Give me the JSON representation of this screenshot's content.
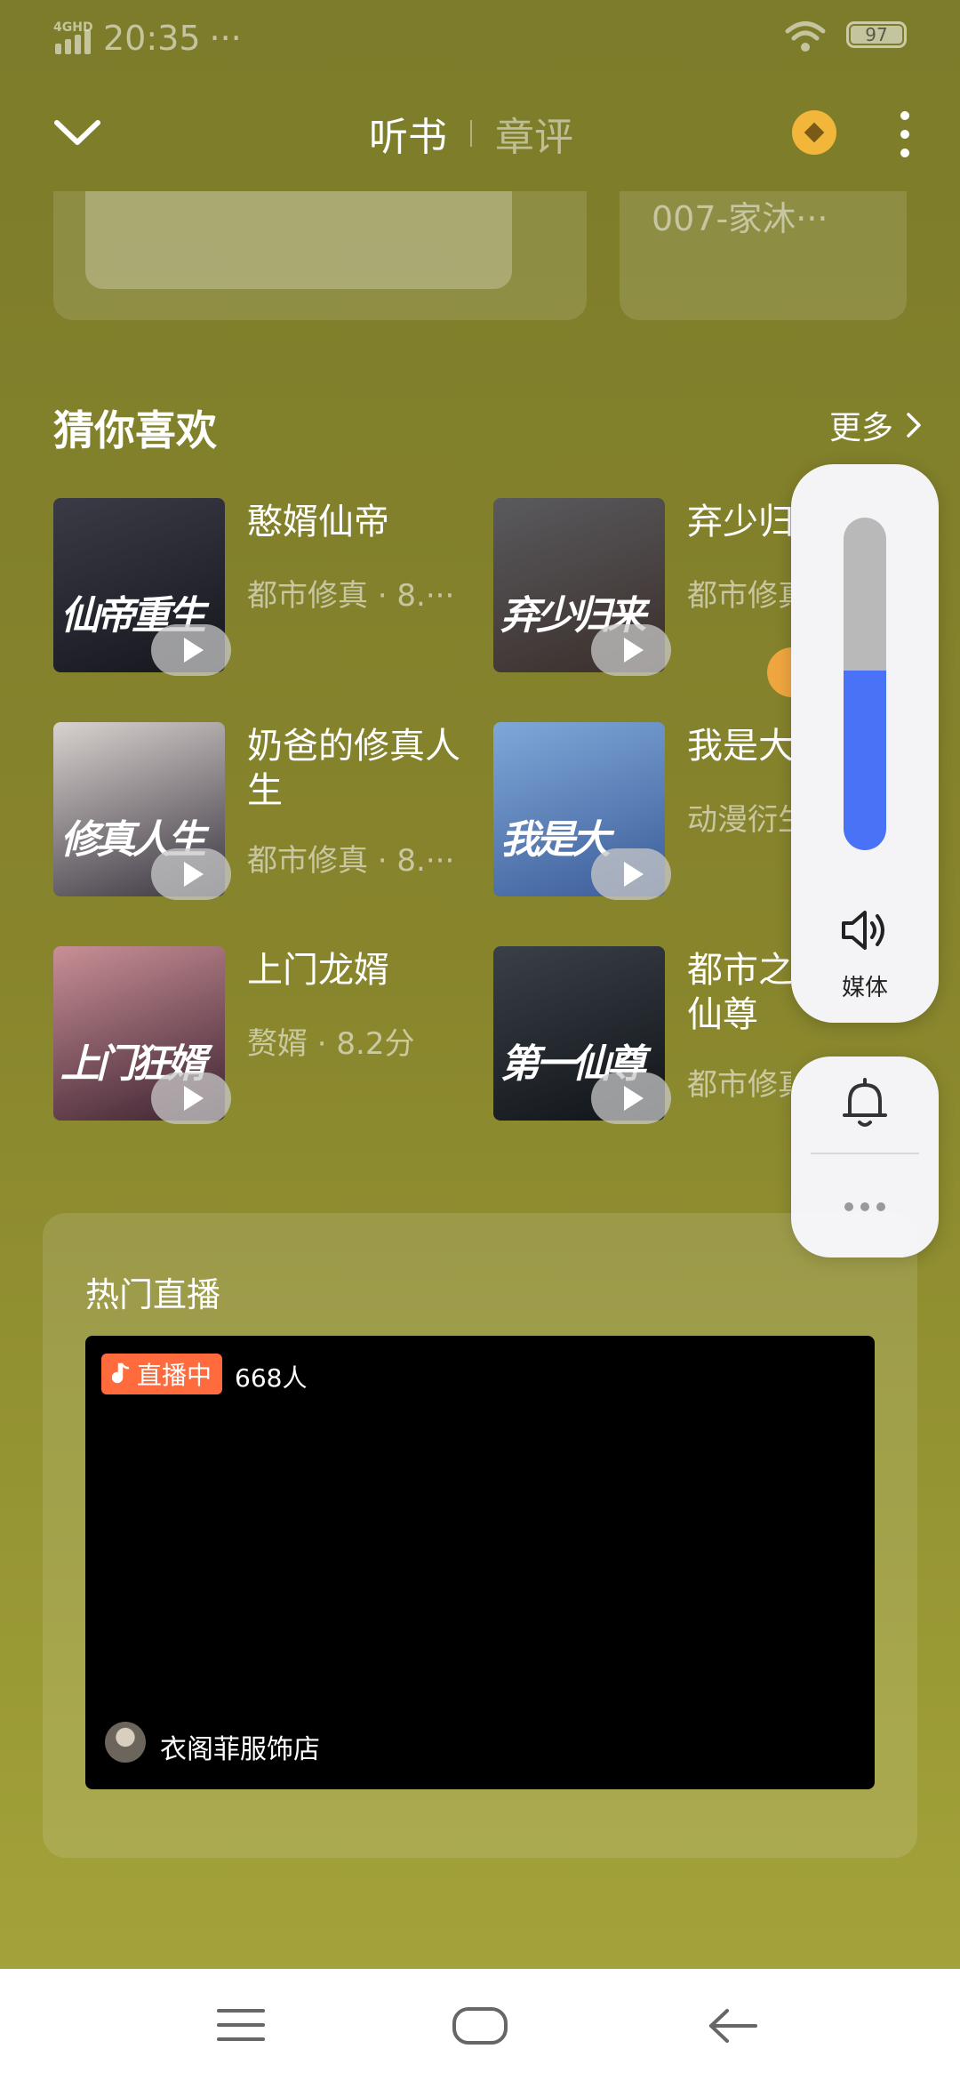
{
  "status": {
    "network": "4GHD",
    "time": "20:35",
    "dots": "···",
    "battery": "97"
  },
  "header": {
    "tab_active": "听书",
    "tab_inactive": "章评"
  },
  "top_cards": {
    "card2_text": "007-家沐···"
  },
  "recommend": {
    "title": "猜你喜欢",
    "more": "更多",
    "books": [
      {
        "title": "憨婿仙帝",
        "meta": "都市修真 · 8.···",
        "cover_text": "仙帝重生",
        "colors": [
          "#3b3b46",
          "#14161d"
        ]
      },
      {
        "title": "弃少归",
        "meta": "都市修真",
        "cover_text": "弃少归来",
        "colors": [
          "#5a5a5e",
          "#3a2e2a"
        ]
      },
      {
        "title": "奶爸的修真人生",
        "meta": "都市修真 · 8.···",
        "cover_text": "修真人生",
        "colors": [
          "#d9d2cf",
          "#3a3540"
        ]
      },
      {
        "title": "我是大",
        "meta": "动漫衍生",
        "cover_text": "我是大",
        "colors": [
          "#7fa8d8",
          "#3c5c99"
        ]
      },
      {
        "title": "上门龙婿",
        "meta": "赘婿 · 8.2分",
        "cover_text": "上门狂婿",
        "colors": [
          "#c98f96",
          "#3c2230"
        ]
      },
      {
        "title": "都市之仙尊",
        "meta": "都市修真",
        "cover_text": "第一仙尊",
        "colors": [
          "#3a4048",
          "#101418"
        ]
      }
    ]
  },
  "volume": {
    "label": "媒体",
    "level": 0.54
  },
  "live": {
    "title": "热门直播",
    "badge": "直播中",
    "viewers": "668人",
    "host": "衣阁菲服饰店"
  }
}
